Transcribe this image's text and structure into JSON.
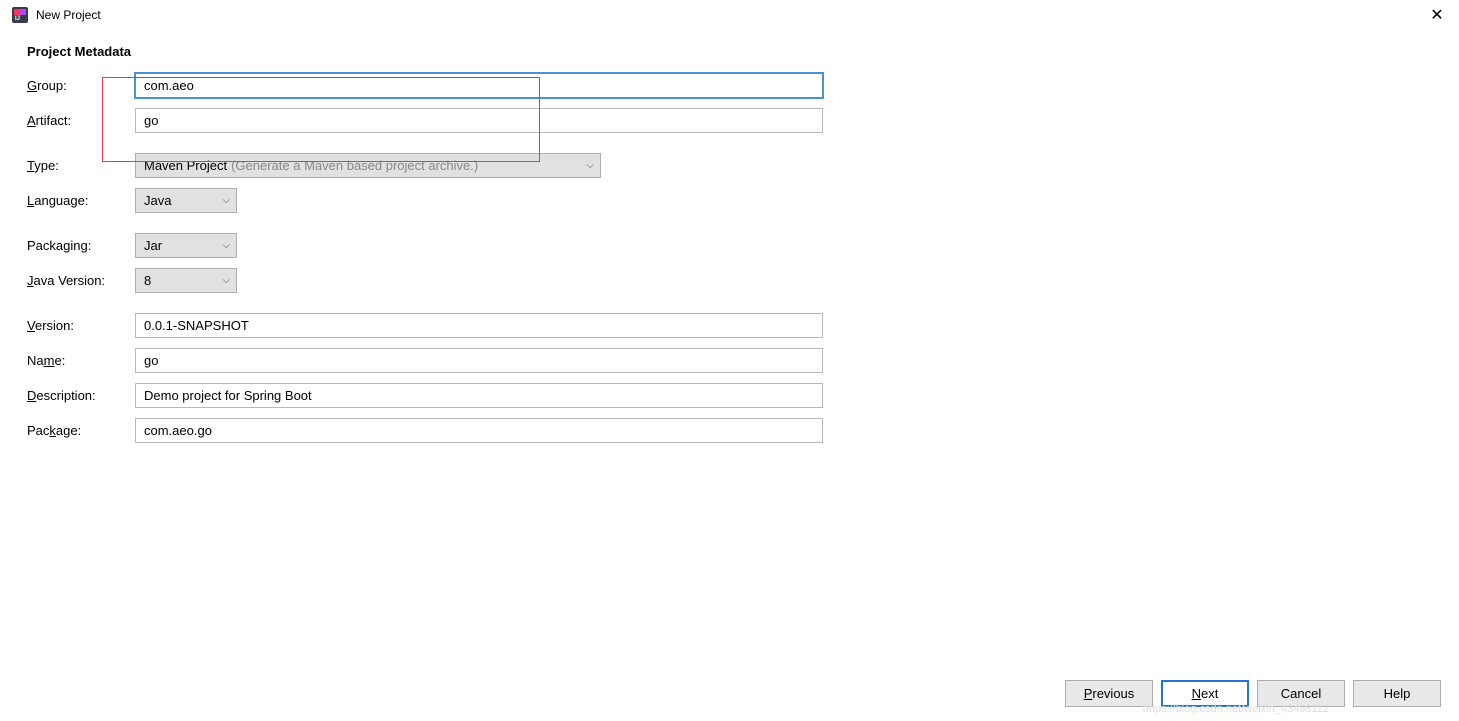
{
  "window": {
    "title": "New Project"
  },
  "section": {
    "heading": "Project Metadata"
  },
  "labels": {
    "group_pre": "",
    "group_u": "G",
    "group_post": "roup:",
    "artifact_pre": "",
    "artifact_u": "A",
    "artifact_post": "rtifact:",
    "type_pre": "",
    "type_u": "T",
    "type_post": "ype:",
    "language_pre": "",
    "language_u": "L",
    "language_post": "anguage:",
    "packaging": "Packaging:",
    "javaversion_pre": "",
    "javaversion_u": "J",
    "javaversion_post": "ava Version:",
    "version_pre": "",
    "version_u": "V",
    "version_post": "ersion:",
    "name_pre": "Na",
    "name_u": "m",
    "name_post": "e:",
    "description_pre": "",
    "description_u": "D",
    "description_post": "escription:",
    "package_pre": "Pac",
    "package_u": "k",
    "package_post": "age:"
  },
  "fields": {
    "group": "com.aeo",
    "artifact": "go",
    "type": "Maven Project",
    "type_hint": "(Generate a Maven based project archive.)",
    "language": "Java",
    "packaging": "Jar",
    "java_version": "8",
    "version": "0.0.1-SNAPSHOT",
    "name": "go",
    "description": "Demo project for Spring Boot",
    "package": "com.aeo.go"
  },
  "buttons": {
    "previous_pre": "",
    "previous_u": "P",
    "previous_post": "revious",
    "next_pre": "",
    "next_u": "N",
    "next_post": "ext",
    "cancel": "Cancel",
    "help": "Help"
  },
  "watermark": "https://blog.csdn.net/weixin_43498112"
}
